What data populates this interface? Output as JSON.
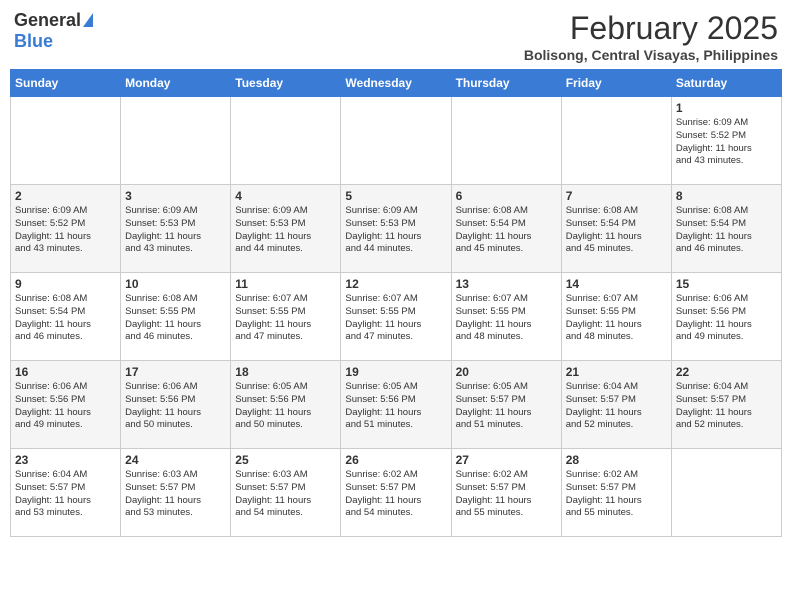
{
  "header": {
    "logo_general": "General",
    "logo_blue": "Blue",
    "month_title": "February 2025",
    "location": "Bolisong, Central Visayas, Philippines"
  },
  "weekdays": [
    "Sunday",
    "Monday",
    "Tuesday",
    "Wednesday",
    "Thursday",
    "Friday",
    "Saturday"
  ],
  "weeks": [
    [
      {
        "day": "",
        "info": ""
      },
      {
        "day": "",
        "info": ""
      },
      {
        "day": "",
        "info": ""
      },
      {
        "day": "",
        "info": ""
      },
      {
        "day": "",
        "info": ""
      },
      {
        "day": "",
        "info": ""
      },
      {
        "day": "1",
        "info": "Sunrise: 6:09 AM\nSunset: 5:52 PM\nDaylight: 11 hours\nand 43 minutes."
      }
    ],
    [
      {
        "day": "2",
        "info": "Sunrise: 6:09 AM\nSunset: 5:52 PM\nDaylight: 11 hours\nand 43 minutes."
      },
      {
        "day": "3",
        "info": "Sunrise: 6:09 AM\nSunset: 5:53 PM\nDaylight: 11 hours\nand 43 minutes."
      },
      {
        "day": "4",
        "info": "Sunrise: 6:09 AM\nSunset: 5:53 PM\nDaylight: 11 hours\nand 44 minutes."
      },
      {
        "day": "5",
        "info": "Sunrise: 6:09 AM\nSunset: 5:53 PM\nDaylight: 11 hours\nand 44 minutes."
      },
      {
        "day": "6",
        "info": "Sunrise: 6:08 AM\nSunset: 5:54 PM\nDaylight: 11 hours\nand 45 minutes."
      },
      {
        "day": "7",
        "info": "Sunrise: 6:08 AM\nSunset: 5:54 PM\nDaylight: 11 hours\nand 45 minutes."
      },
      {
        "day": "8",
        "info": "Sunrise: 6:08 AM\nSunset: 5:54 PM\nDaylight: 11 hours\nand 46 minutes."
      }
    ],
    [
      {
        "day": "9",
        "info": "Sunrise: 6:08 AM\nSunset: 5:54 PM\nDaylight: 11 hours\nand 46 minutes."
      },
      {
        "day": "10",
        "info": "Sunrise: 6:08 AM\nSunset: 5:55 PM\nDaylight: 11 hours\nand 46 minutes."
      },
      {
        "day": "11",
        "info": "Sunrise: 6:07 AM\nSunset: 5:55 PM\nDaylight: 11 hours\nand 47 minutes."
      },
      {
        "day": "12",
        "info": "Sunrise: 6:07 AM\nSunset: 5:55 PM\nDaylight: 11 hours\nand 47 minutes."
      },
      {
        "day": "13",
        "info": "Sunrise: 6:07 AM\nSunset: 5:55 PM\nDaylight: 11 hours\nand 48 minutes."
      },
      {
        "day": "14",
        "info": "Sunrise: 6:07 AM\nSunset: 5:55 PM\nDaylight: 11 hours\nand 48 minutes."
      },
      {
        "day": "15",
        "info": "Sunrise: 6:06 AM\nSunset: 5:56 PM\nDaylight: 11 hours\nand 49 minutes."
      }
    ],
    [
      {
        "day": "16",
        "info": "Sunrise: 6:06 AM\nSunset: 5:56 PM\nDaylight: 11 hours\nand 49 minutes."
      },
      {
        "day": "17",
        "info": "Sunrise: 6:06 AM\nSunset: 5:56 PM\nDaylight: 11 hours\nand 50 minutes."
      },
      {
        "day": "18",
        "info": "Sunrise: 6:05 AM\nSunset: 5:56 PM\nDaylight: 11 hours\nand 50 minutes."
      },
      {
        "day": "19",
        "info": "Sunrise: 6:05 AM\nSunset: 5:56 PM\nDaylight: 11 hours\nand 51 minutes."
      },
      {
        "day": "20",
        "info": "Sunrise: 6:05 AM\nSunset: 5:57 PM\nDaylight: 11 hours\nand 51 minutes."
      },
      {
        "day": "21",
        "info": "Sunrise: 6:04 AM\nSunset: 5:57 PM\nDaylight: 11 hours\nand 52 minutes."
      },
      {
        "day": "22",
        "info": "Sunrise: 6:04 AM\nSunset: 5:57 PM\nDaylight: 11 hours\nand 52 minutes."
      }
    ],
    [
      {
        "day": "23",
        "info": "Sunrise: 6:04 AM\nSunset: 5:57 PM\nDaylight: 11 hours\nand 53 minutes."
      },
      {
        "day": "24",
        "info": "Sunrise: 6:03 AM\nSunset: 5:57 PM\nDaylight: 11 hours\nand 53 minutes."
      },
      {
        "day": "25",
        "info": "Sunrise: 6:03 AM\nSunset: 5:57 PM\nDaylight: 11 hours\nand 54 minutes."
      },
      {
        "day": "26",
        "info": "Sunrise: 6:02 AM\nSunset: 5:57 PM\nDaylight: 11 hours\nand 54 minutes."
      },
      {
        "day": "27",
        "info": "Sunrise: 6:02 AM\nSunset: 5:57 PM\nDaylight: 11 hours\nand 55 minutes."
      },
      {
        "day": "28",
        "info": "Sunrise: 6:02 AM\nSunset: 5:57 PM\nDaylight: 11 hours\nand 55 minutes."
      },
      {
        "day": "",
        "info": ""
      }
    ]
  ]
}
